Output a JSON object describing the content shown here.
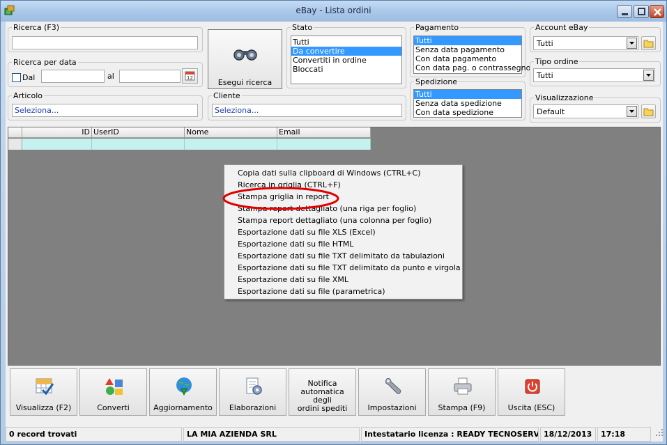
{
  "window": {
    "title": "eBay - Lista ordini"
  },
  "search": {
    "ricerca_legend": "Ricerca (F3)",
    "ricerca_value": "",
    "data_legend": "Ricerca per data",
    "dal_label": "Dal",
    "al_label": "al",
    "dal_value": "",
    "al_value": "",
    "esegui_label": "Esegui ricerca",
    "articolo_legend": "Articolo",
    "articolo_value": "Seleziona...",
    "cliente_legend": "Cliente",
    "cliente_value": "Seleziona..."
  },
  "stato": {
    "legend": "Stato",
    "options": [
      "Tutti",
      "Da convertire",
      "Convertiti in ordine",
      "Bloccati"
    ],
    "selected": "Da convertire"
  },
  "pagamento": {
    "legend": "Pagamento",
    "options": [
      "Tutti",
      "Senza data pagamento",
      "Con data pagamento",
      "Con data pag. o contrassegno"
    ],
    "selected": "Tutti"
  },
  "spedizione": {
    "legend": "Spedizione",
    "options": [
      "Tutti",
      "Senza data spedizione",
      "Con data spedizione"
    ],
    "selected": "Tutti"
  },
  "account": {
    "legend": "Account eBay",
    "value": "Tutti"
  },
  "tipo": {
    "legend": "Tipo ordine",
    "value": "Tutti"
  },
  "visualizzazione": {
    "legend": "Visualizzazione",
    "value": "Default"
  },
  "grid": {
    "columns": [
      "ID",
      "UserID",
      "Nome",
      "Email"
    ]
  },
  "context_menu": {
    "items": [
      "Copia dati sulla clipboard di Windows (CTRL+C)",
      "Ricerca in griglia (CTRL+F)",
      "Stampa griglia in report",
      "Stampa report dettagliato (una riga per foglio)",
      "Stampa report dettagliato (una colonna per foglio)",
      "Esportazione dati su file XLS (Excel)",
      "Esportazione dati su file HTML",
      "Esportazione dati su file TXT delimitato da tabulazioni",
      "Esportazione dati su file TXT delimitato da punto e virgola",
      "Esportazione dati su file XML",
      "Esportazione dati su file (parametrica)"
    ],
    "highlighted": "Stampa griglia in report",
    "highlight_color": "#e00000"
  },
  "toolbar": {
    "visualizza": "Visualizza (F2)",
    "converti": "Converti",
    "aggiornamento": "Aggiornamento",
    "elaborazioni": "Elaborazioni",
    "notifica_line1": "Notifica",
    "notifica_line2": "automatica degli",
    "notifica_line3": "ordini spediti",
    "impostazioni": "Impostazioni",
    "stampa": "Stampa (F9)",
    "uscita": "Uscita (ESC)"
  },
  "status": {
    "records": "0 record trovati",
    "company": "LA MIA AZIENDA SRL",
    "license": "Intestatario licenza : READY TECNOSERVICE S",
    "date": "18/12/2013",
    "time": "17:18"
  },
  "colors": {
    "selection": "#3399ff",
    "grid_bg": "#808080",
    "grid_row": "#c5f1ee",
    "link_text": "#1f3fa8"
  }
}
